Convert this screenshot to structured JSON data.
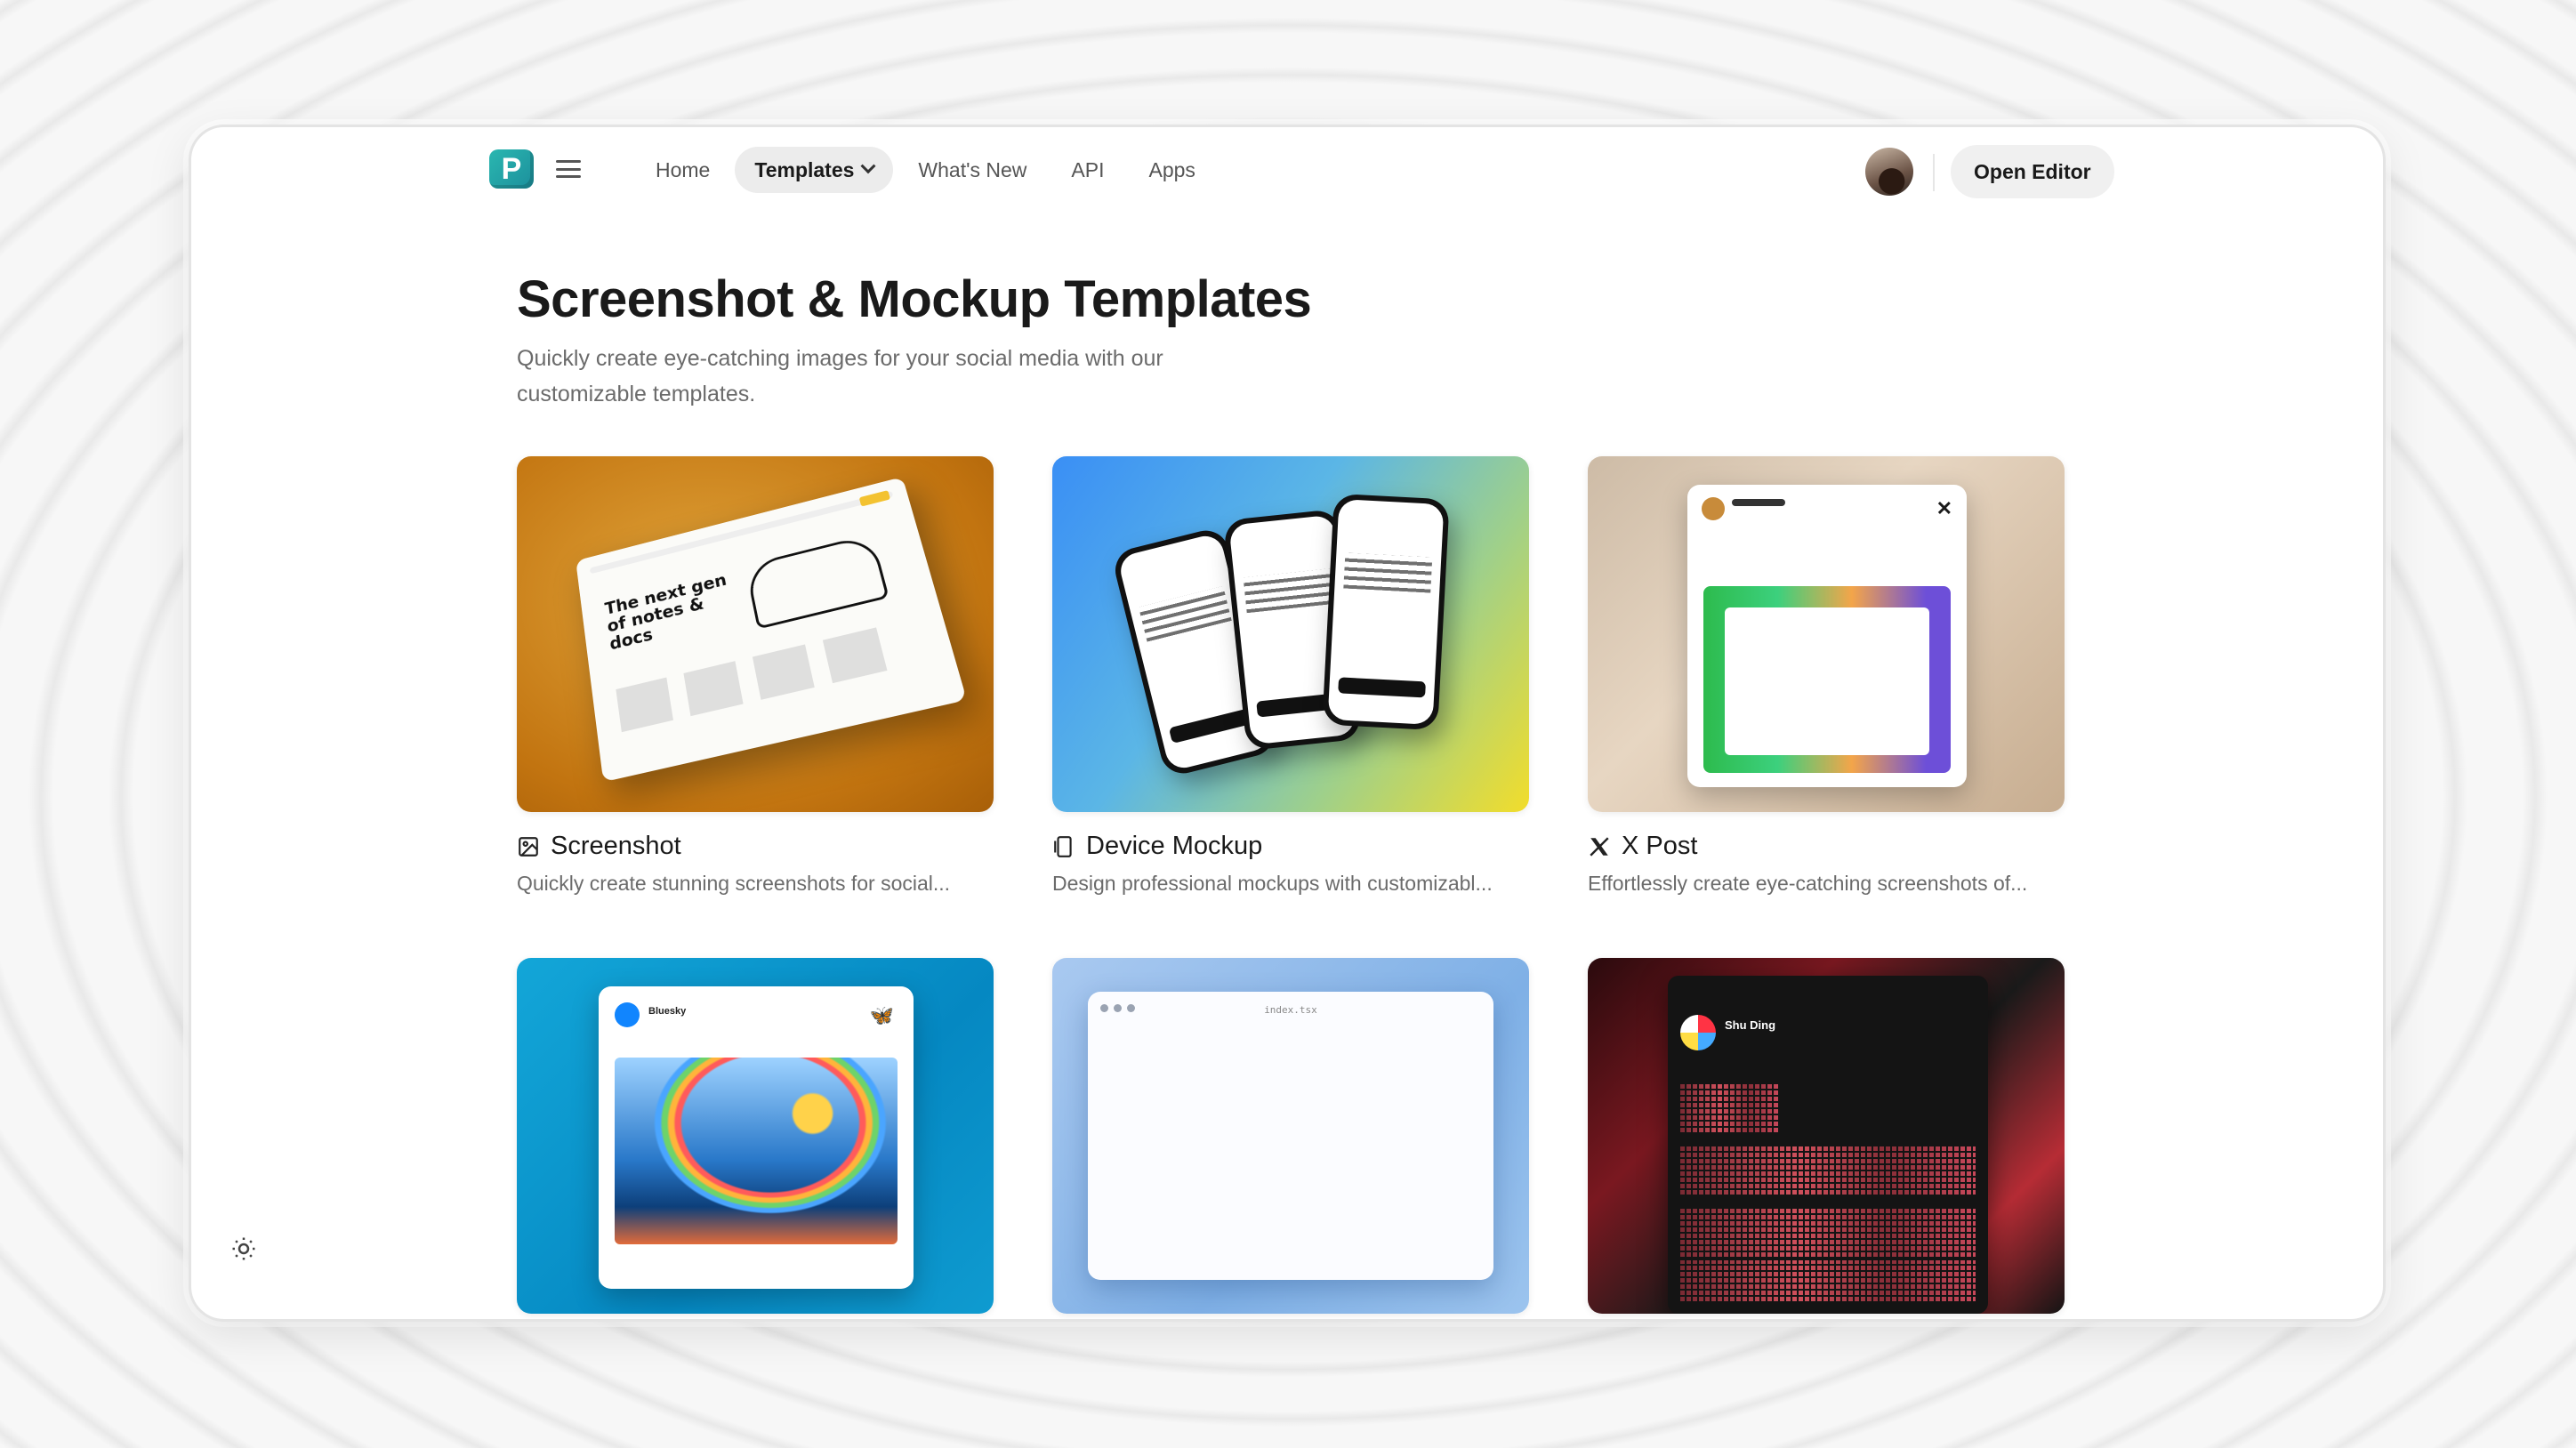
{
  "nav": {
    "logo_letter": "P",
    "links": [
      {
        "label": "Home"
      },
      {
        "label": "Templates"
      },
      {
        "label": "What's New"
      },
      {
        "label": "API"
      },
      {
        "label": "Apps"
      }
    ],
    "active": "Templates",
    "open_editor_label": "Open Editor"
  },
  "page": {
    "title": "Screenshot & Mockup Templates",
    "subtitle": "Quickly create eye-catching images for your social media with our customizable templates."
  },
  "cards": [
    {
      "title": "Screenshot",
      "description": "Quickly create stunning screenshots for social...",
      "icon": "image-icon",
      "preview_text": "The next gen of notes & docs"
    },
    {
      "title": "Device Mockup",
      "description": "Design professional mockups with customizabl...",
      "icon": "phone-icon"
    },
    {
      "title": "X Post",
      "description": "Effortlessly create eye-catching screenshots of...",
      "icon": "x-logo-icon"
    },
    {
      "title": "",
      "description": "",
      "icon": "",
      "preview_text": "Bluesky"
    },
    {
      "title": "",
      "description": "",
      "icon": "",
      "preview_filename": "index.tsx"
    },
    {
      "title": "",
      "description": "",
      "icon": "",
      "preview_text": "Shu Ding"
    }
  ],
  "colors": {
    "accent": "#2ab7b0",
    "bluesky": "#1185fe"
  }
}
